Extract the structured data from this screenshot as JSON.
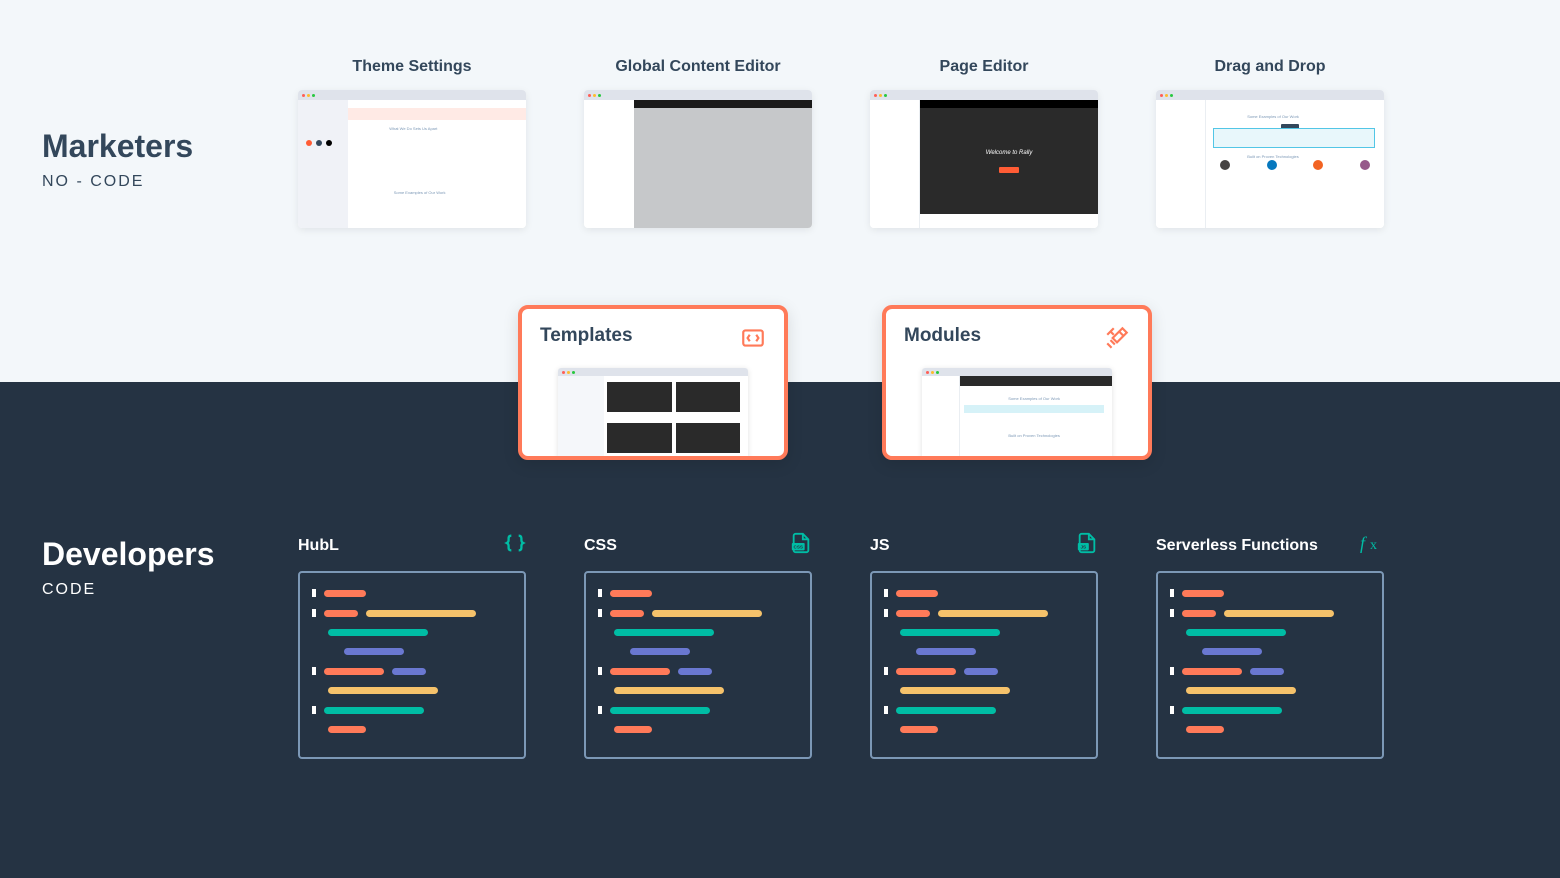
{
  "sections": {
    "marketers": {
      "title": "Marketers",
      "subtitle": "NO - CODE"
    },
    "developers": {
      "title": "Developers",
      "subtitle": "CODE"
    }
  },
  "marketer_tools": [
    {
      "label": "Theme Settings"
    },
    {
      "label": "Global Content Editor"
    },
    {
      "label": "Page Editor",
      "hero_text": "Welcome to Rally"
    },
    {
      "label": "Drag and Drop",
      "caption1": "Some Examples of Our Work",
      "caption2": "Built on Proven Technologies"
    }
  ],
  "bridge_cards": [
    {
      "label": "Templates",
      "icon": "templates-icon"
    },
    {
      "label": "Modules",
      "icon": "tools-icon",
      "caption1": "Some Examples of Our Work",
      "caption2": "Built on Proven Technologies"
    }
  ],
  "developer_tools": [
    {
      "label": "HubL",
      "icon": "braces-icon"
    },
    {
      "label": "CSS",
      "icon": "css-file-icon"
    },
    {
      "label": "JS",
      "icon": "js-file-icon"
    },
    {
      "label": "Serverless Functions",
      "icon": "fx-icon"
    }
  ],
  "colors": {
    "accent_orange": "#ff7a59",
    "accent_teal": "#00bda5",
    "dark_bg": "#253343",
    "light_bg": "#f3f7fa",
    "heading": "#33475b"
  }
}
